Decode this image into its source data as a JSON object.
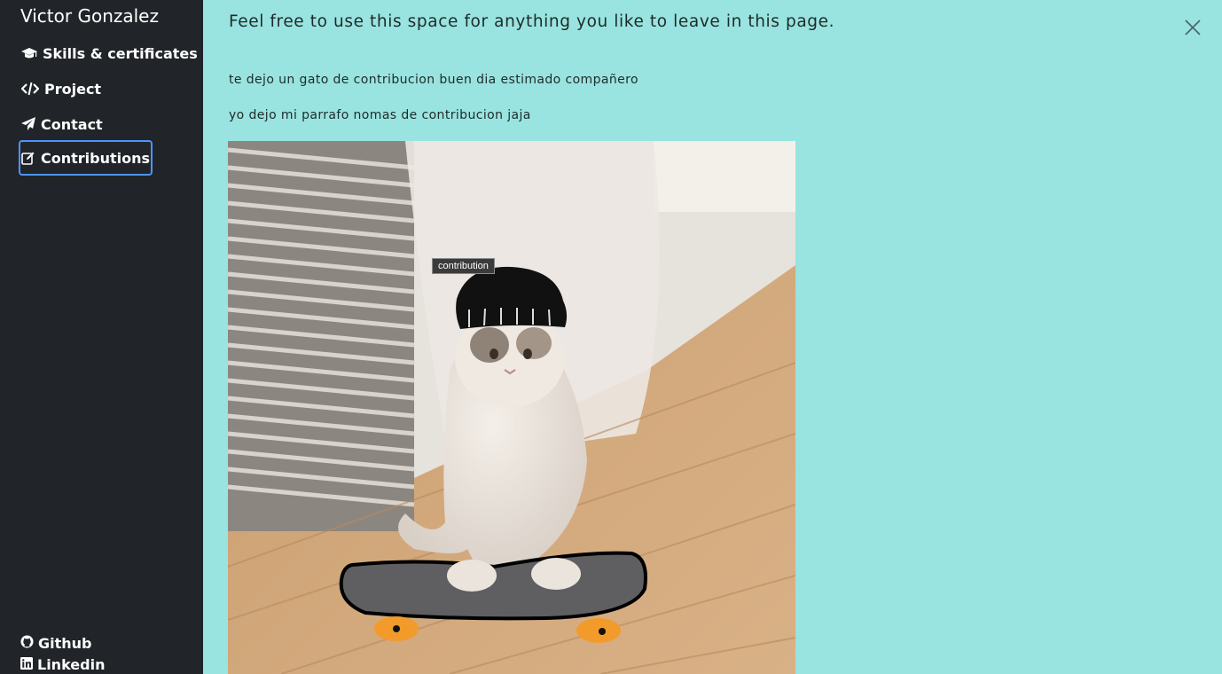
{
  "sidebar": {
    "brand": "Victor Gonzalez",
    "items": [
      {
        "label": "Skills & certificates",
        "icon": "graduation-cap-icon"
      },
      {
        "label": "Project",
        "icon": "code-icon"
      },
      {
        "label": "Contact",
        "icon": "paper-plane-icon"
      },
      {
        "label": "Contributions",
        "icon": "edit-icon",
        "active": true
      }
    ],
    "footer": [
      {
        "label": "Github",
        "icon": "github-icon"
      },
      {
        "label": "Linkedin",
        "icon": "linkedin-icon"
      }
    ]
  },
  "main": {
    "heading": "Feel free to use this space for anything you like to leave in this page.",
    "paragraphs": [
      "te dejo un gato de contribucion buen dia estimado compañero",
      "yo dejo mi parrafo nomas de contribucion jaja"
    ],
    "image_tooltip": "contribution",
    "close_icon": "close-icon"
  },
  "colors": {
    "sidebar_bg": "#212529",
    "main_bg": "#99e4e0",
    "active_border": "#4d94ff"
  }
}
